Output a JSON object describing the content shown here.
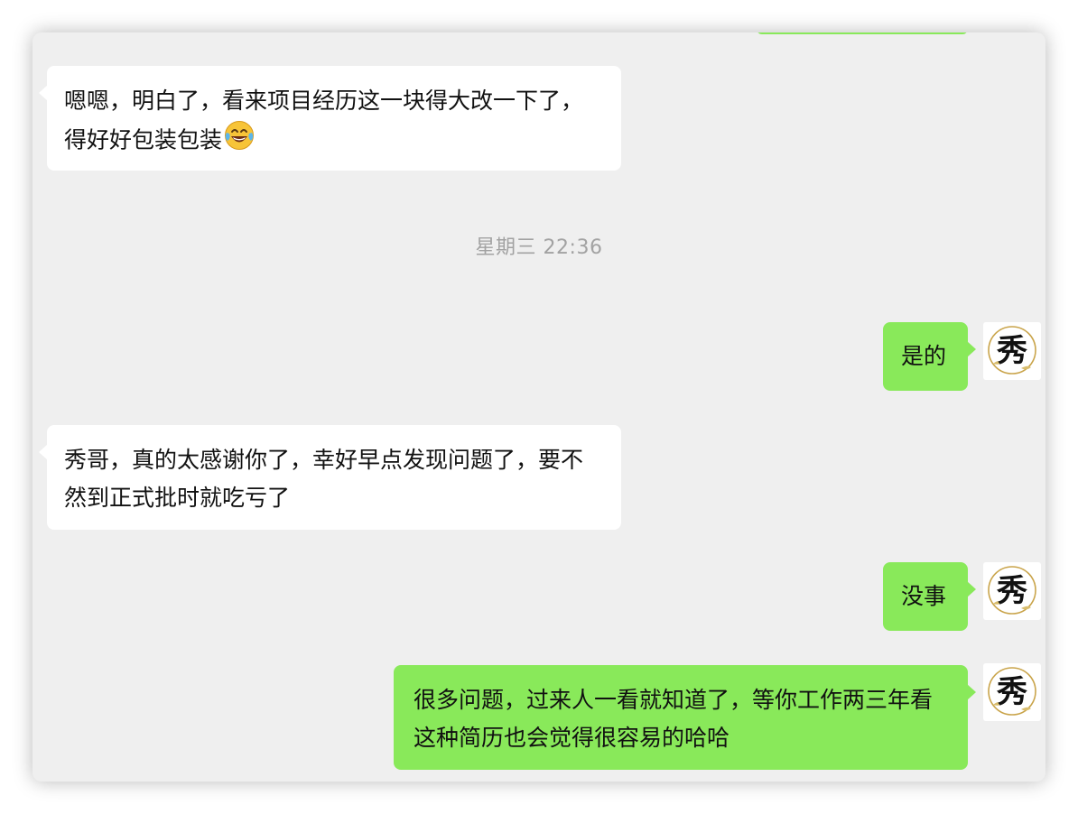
{
  "chat": {
    "timestamp": "星期三 22:36",
    "messages": [
      {
        "side": "left",
        "text": "嗯嗯，明白了，看来项目经历这一块得大改一下了，得好好包装包装",
        "emoji": "face-with-tears-of-joy"
      },
      {
        "side": "right",
        "text": "是的"
      },
      {
        "side": "left",
        "text": "秀哥，真的太感谢你了，幸好早点发现问题了，要不然到正式批时就吃亏了"
      },
      {
        "side": "right",
        "text": "没事"
      },
      {
        "side": "right",
        "text": "很多问题，过来人一看就知道了，等你工作两三年看这种简历也会觉得很容易的哈哈"
      }
    ],
    "avatar": {
      "glyph": "秀",
      "icon": "calligraphy-avatar-icon"
    }
  },
  "colors": {
    "background": "#efefef",
    "bubble_left": "#ffffff",
    "bubble_right": "#89e95a",
    "timestamp": "#a2a2a2",
    "text": "#111111"
  }
}
